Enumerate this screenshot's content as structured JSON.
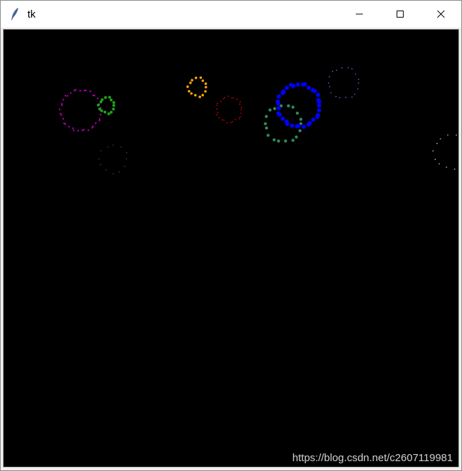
{
  "window": {
    "title": "tk"
  },
  "caption": {
    "minimize_icon": "minimize-icon",
    "maximize_icon": "maximize-icon",
    "close_icon": "close-icon"
  },
  "canvas": {
    "background": "#000000",
    "fireworks": [
      {
        "name": "purple-burst",
        "color": "#b000b0",
        "dots": 38
      },
      {
        "name": "green-burst",
        "color": "#1fa31f",
        "dots": 14
      },
      {
        "name": "faint-green-burst",
        "color": "#2a5a2a",
        "dots": 12
      },
      {
        "name": "orange-burst",
        "color": "#ffa500",
        "dots": 14
      },
      {
        "name": "red-burst",
        "color": "#d00000",
        "dots": 26
      },
      {
        "name": "seagreen-burst",
        "color": "#2e8b57",
        "dots": 18
      },
      {
        "name": "blue-burst",
        "color": "#0000ff",
        "dots": 34
      },
      {
        "name": "slateblue-burst",
        "color": "#6a6aff",
        "dots": 18
      },
      {
        "name": "lightblue-burst",
        "color": "#add8e6",
        "dots": 14
      }
    ]
  },
  "watermark": "https://blog.csdn.net/c2607119981"
}
